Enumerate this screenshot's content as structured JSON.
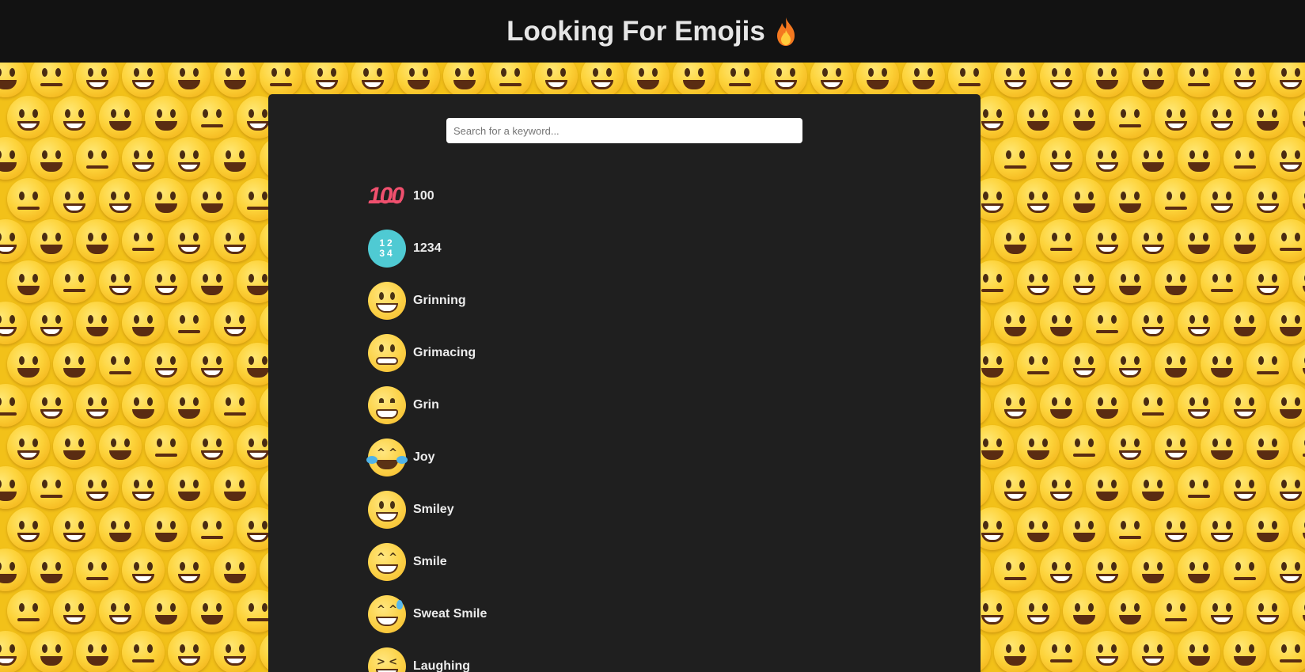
{
  "header": {
    "title": "Looking For Emojis",
    "title_icon": "fire-icon"
  },
  "search": {
    "placeholder": "Search for a keyword...",
    "value": ""
  },
  "emojis": [
    {
      "label": "100",
      "icon": "hundred-points-icon"
    },
    {
      "label": "1234",
      "icon": "input-numbers-icon"
    },
    {
      "label": "Grinning",
      "icon": "grinning-face-icon"
    },
    {
      "label": "Grimacing",
      "icon": "grimacing-face-icon"
    },
    {
      "label": "Grin",
      "icon": "grin-face-icon"
    },
    {
      "label": "Joy",
      "icon": "joy-face-icon"
    },
    {
      "label": "Smiley",
      "icon": "smiley-face-icon"
    },
    {
      "label": "Smile",
      "icon": "smile-face-icon"
    },
    {
      "label": "Sweat Smile",
      "icon": "sweat-smile-face-icon"
    },
    {
      "label": "Laughing",
      "icon": "laughing-face-icon"
    }
  ],
  "colors": {
    "header_bg": "#121212",
    "panel_bg": "#1f1f1f",
    "background": "#f2c119",
    "text": "#ececec"
  }
}
